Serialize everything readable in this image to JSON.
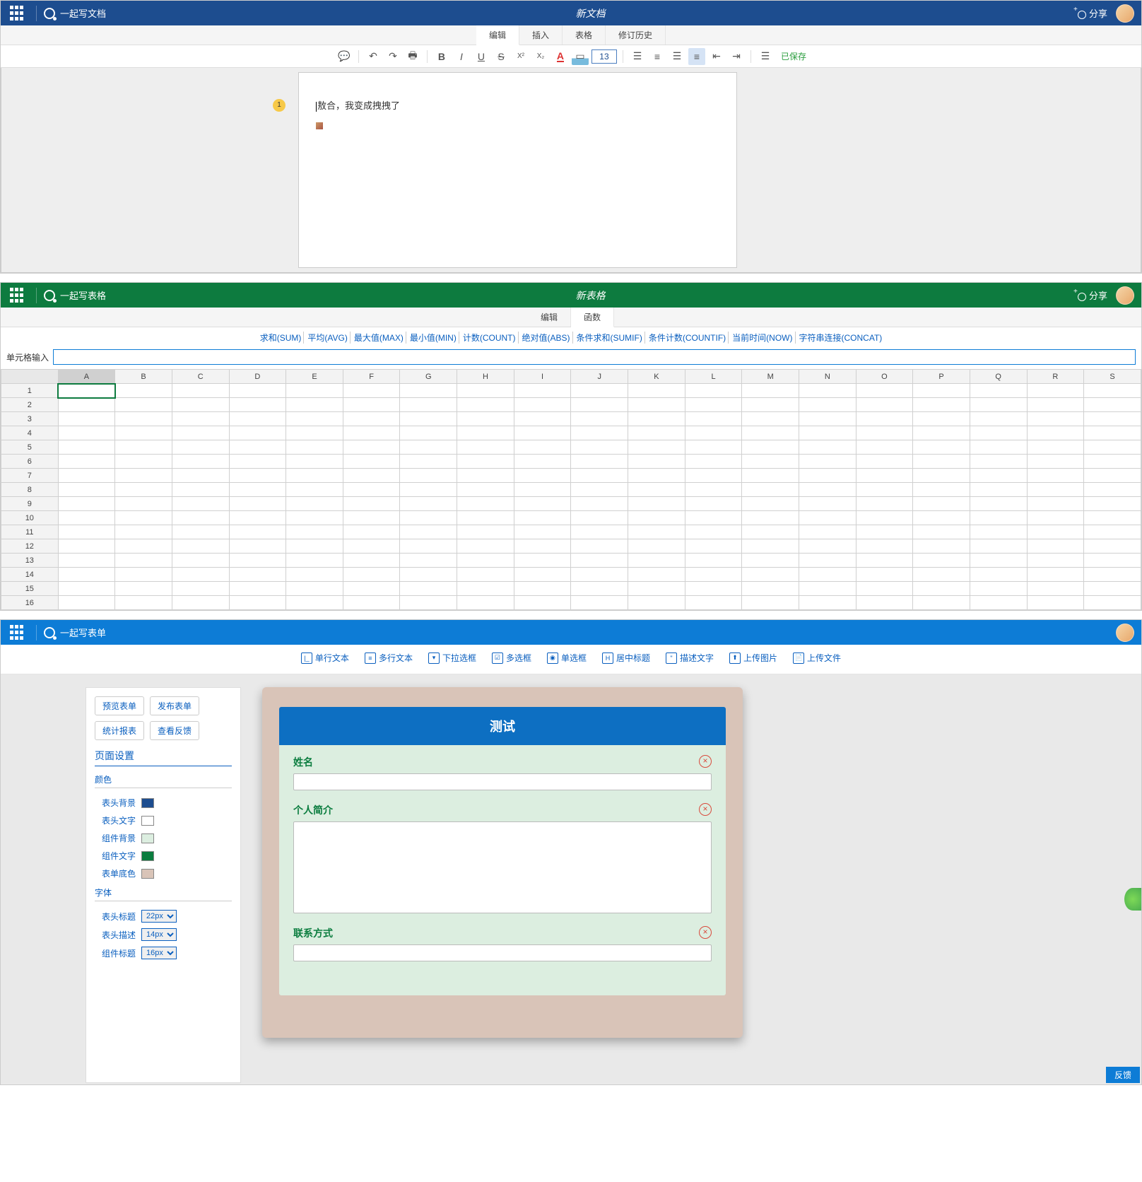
{
  "doc": {
    "product": "一起写文档",
    "title": "新文档",
    "share": "分享",
    "tabs": [
      "编辑",
      "插入",
      "表格",
      "修订历史"
    ],
    "active_tab": 0,
    "fontsize": "13",
    "saved": "已保存",
    "comment_count": "1",
    "content": "敖合，我变成拽拽了"
  },
  "sheet": {
    "product": "一起写表格",
    "title": "新表格",
    "share": "分享",
    "tabs": [
      "编辑",
      "函数"
    ],
    "active_tab": 1,
    "functions": [
      "求和(SUM)",
      "平均(AVG)",
      "最大值(MAX)",
      "最小值(MIN)",
      "计数(COUNT)",
      "绝对值(ABS)",
      "条件求和(SUMIF)",
      "条件计数(COUNTIF)",
      "当前时间(NOW)",
      "字符串连接(CONCAT)"
    ],
    "cell_input_label": "单元格输入",
    "columns": [
      "",
      "A",
      "B",
      "C",
      "D",
      "E",
      "F",
      "G",
      "H",
      "I",
      "J",
      "K",
      "L",
      "M",
      "N",
      "O",
      "P",
      "Q",
      "R",
      "S"
    ],
    "rows": 16
  },
  "form": {
    "product": "一起写表单",
    "toolbar": [
      {
        "icon": "|_",
        "label": "单行文本"
      },
      {
        "icon": "≡",
        "label": "多行文本"
      },
      {
        "icon": "▾",
        "label": "下拉选框"
      },
      {
        "icon": "☑",
        "label": "多选框"
      },
      {
        "icon": "◉",
        "label": "单选框"
      },
      {
        "icon": "H",
        "label": "居中标题"
      },
      {
        "icon": "\"",
        "label": "描述文字"
      },
      {
        "icon": "⬆",
        "label": "上传图片"
      },
      {
        "icon": "📄",
        "label": "上传文件"
      }
    ],
    "side": {
      "buttons": [
        "预览表单",
        "发布表单",
        "统计报表",
        "查看反馈"
      ],
      "section": "页面设置",
      "color_title": "颜色",
      "colors": [
        {
          "label": "表头背景",
          "val": "#1d4d8f"
        },
        {
          "label": "表头文字",
          "val": "#ffffff"
        },
        {
          "label": "组件背景",
          "val": "#dceee0"
        },
        {
          "label": "组件文字",
          "val": "#0b7d3f"
        },
        {
          "label": "表单底色",
          "val": "#d9c4b8"
        }
      ],
      "font_title": "字体",
      "fonts": [
        {
          "label": "表头标题",
          "val": "22px"
        },
        {
          "label": "表头描述",
          "val": "14px"
        },
        {
          "label": "组件标题",
          "val": "16px"
        }
      ]
    },
    "canvas": {
      "title": "测试",
      "components": [
        {
          "title": "姓名",
          "type": "input"
        },
        {
          "title": "个人简介",
          "type": "textarea"
        },
        {
          "title": "联系方式",
          "type": "input"
        }
      ]
    },
    "feedback": "反馈"
  }
}
